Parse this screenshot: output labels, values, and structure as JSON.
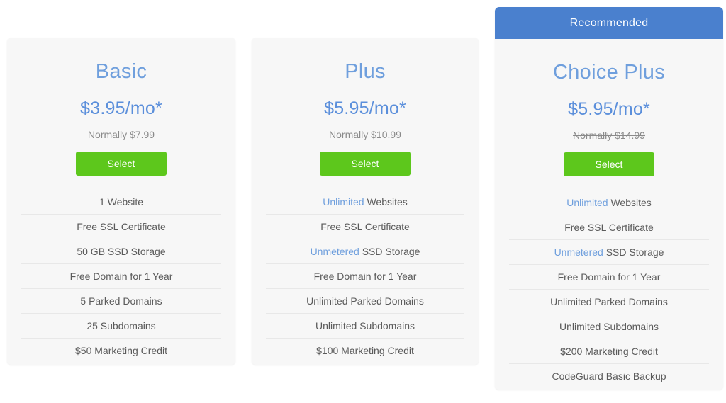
{
  "plans": [
    {
      "id": "basic",
      "name": "Basic",
      "price": "$3.95/mo*",
      "normally": "Normally $7.99",
      "select_label": "Select",
      "recommended": false,
      "features": [
        {
          "highlight": "",
          "text": "1 Website"
        },
        {
          "highlight": "",
          "text": "Free SSL Certificate"
        },
        {
          "highlight": "",
          "text": "50 GB SSD Storage"
        },
        {
          "highlight": "",
          "text": "Free Domain for 1 Year"
        },
        {
          "highlight": "",
          "text": "5 Parked Domains"
        },
        {
          "highlight": "",
          "text": "25 Subdomains"
        },
        {
          "highlight": "",
          "text": "$50 Marketing Credit"
        }
      ]
    },
    {
      "id": "plus",
      "name": "Plus",
      "price": "$5.95/mo*",
      "normally": "Normally $10.99",
      "select_label": "Select",
      "recommended": false,
      "features": [
        {
          "highlight": "Unlimited",
          "text": "Websites"
        },
        {
          "highlight": "",
          "text": "Free SSL Certificate"
        },
        {
          "highlight": "Unmetered",
          "text": "SSD Storage"
        },
        {
          "highlight": "",
          "text": "Free Domain for 1 Year"
        },
        {
          "highlight": "",
          "text": "Unlimited Parked Domains"
        },
        {
          "highlight": "",
          "text": "Unlimited Subdomains"
        },
        {
          "highlight": "",
          "text": "$100 Marketing Credit"
        }
      ]
    },
    {
      "id": "choice",
      "name": "Choice Plus",
      "price": "$5.95/mo*",
      "normally": "Normally $14.99",
      "select_label": "Select",
      "recommended": true,
      "recommended_label": "Recommended",
      "features": [
        {
          "highlight": "Unlimited",
          "text": "Websites"
        },
        {
          "highlight": "",
          "text": "Free SSL Certificate"
        },
        {
          "highlight": "Unmetered",
          "text": "SSD Storage"
        },
        {
          "highlight": "",
          "text": "Free Domain for 1 Year"
        },
        {
          "highlight": "",
          "text": "Unlimited Parked Domains"
        },
        {
          "highlight": "",
          "text": "Unlimited Subdomains"
        },
        {
          "highlight": "",
          "text": "$200 Marketing Credit"
        },
        {
          "highlight": "",
          "text": "CodeGuard Basic Backup"
        }
      ]
    }
  ],
  "colors": {
    "recommended_banner": "#4a80ce",
    "plan_title": "#6f9fdd",
    "price": "#5b8fdb",
    "select_button": "#5dc71c",
    "card_background": "#f7f7f7",
    "feature_text": "#5a5a5a",
    "divider": "#e8e8e8",
    "normally_text": "#8a8a8a"
  }
}
